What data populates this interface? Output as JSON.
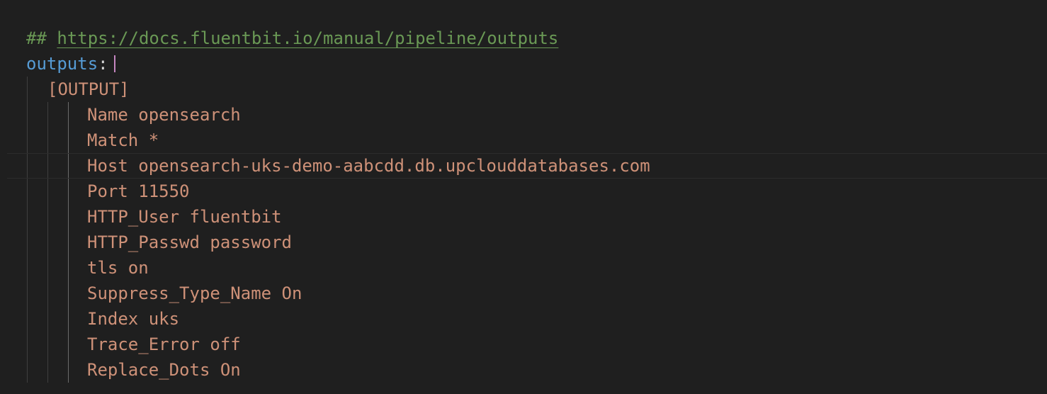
{
  "editor": {
    "comment_prefix": "##",
    "comment_url": "https://docs.fluentbit.io/manual/pipeline/outputs",
    "key": "outputs",
    "colon": ":",
    "section_header": "[OUTPUT]",
    "lines": [
      "Name opensearch",
      "Match *",
      "Host opensearch-uks-demo-aabcdd.db.upclouddatabases.com",
      "Port 11550",
      "HTTP_User fluentbit",
      "HTTP_Passwd password",
      "tls on",
      "Suppress_Type_Name On",
      "Index uks",
      "Trace_Error off",
      "Replace_Dots On"
    ]
  }
}
